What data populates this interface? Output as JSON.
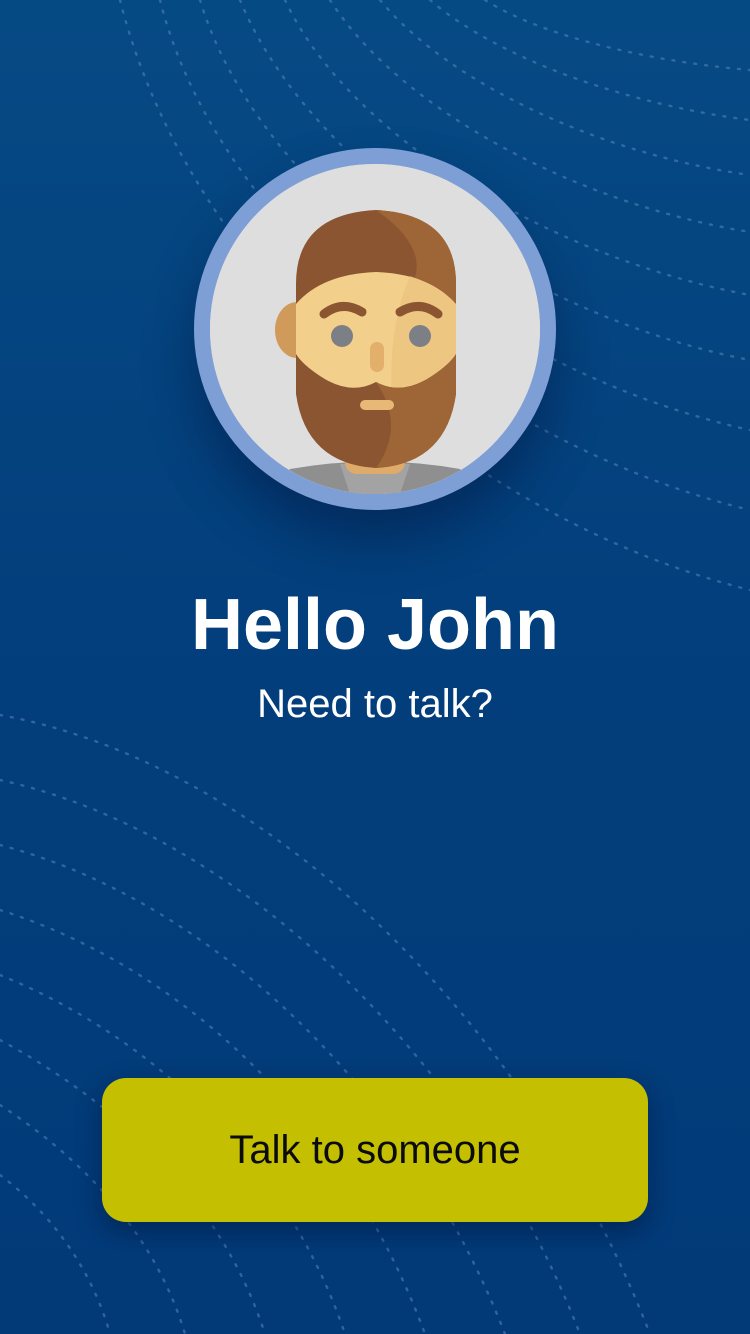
{
  "profile": {
    "avatar_icon": "bearded-man-avatar-icon",
    "greeting": "Hello John",
    "subtitle": "Need to talk?"
  },
  "actions": {
    "talk_label": "Talk to someone"
  },
  "colors": {
    "background": "#033f7c",
    "avatar_ring": "#7e9fd6",
    "button": "#c4bf00",
    "text_light": "#ffffff",
    "button_text": "#0b0b0b"
  }
}
